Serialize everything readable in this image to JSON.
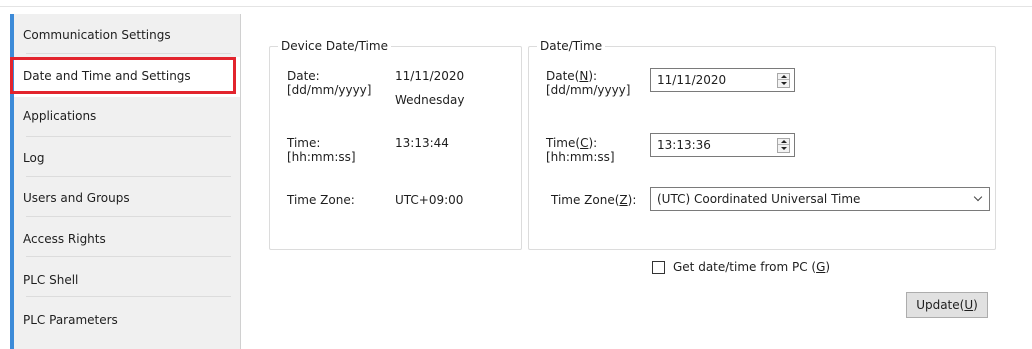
{
  "sidebar": {
    "items": [
      {
        "label": "Communication Settings"
      },
      {
        "label": "Date and Time and Settings",
        "selected": true
      },
      {
        "label": "Applications"
      },
      {
        "label": "Log"
      },
      {
        "label": "Users and Groups"
      },
      {
        "label": "Access Rights"
      },
      {
        "label": "PLC Shell"
      },
      {
        "label": "PLC Parameters"
      }
    ]
  },
  "device": {
    "title": "Device Date/Time",
    "date_label": "Date:",
    "date_format": "[dd/mm/yyyy]",
    "date_value": "11/11/2020",
    "weekday": "Wednesday",
    "time_label": "Time:",
    "time_format": "[hh:mm:ss]",
    "time_value": "13:13:44",
    "tz_label": "Time Zone:",
    "tz_value": "UTC+09:00"
  },
  "datetime": {
    "title": "Date/Time",
    "date_label_pre": "Date(",
    "date_key": "N",
    "date_label_post": "):",
    "date_format": "[dd/mm/yyyy]",
    "date_value": "11/11/2020",
    "time_label_pre": "Time(",
    "time_key": "C",
    "time_label_post": "):",
    "time_format": "[hh:mm:ss]",
    "time_value": "13:13:36",
    "tz_label_pre": "Time Zone(",
    "tz_key": "Z",
    "tz_label_post": "):",
    "tz_value": "(UTC) Coordinated Universal Time"
  },
  "get_from_pc": {
    "label_pre": "Get date/time from PC (",
    "key": "G",
    "label_post": ")",
    "checked": false
  },
  "update_button": {
    "label_pre": "Update(",
    "key": "U",
    "label_post": ")"
  },
  "colors": {
    "selection_border": "#e2242d",
    "sidebar_accent": "#3d8bd8",
    "sidebar_bg": "#f0f0f0"
  }
}
